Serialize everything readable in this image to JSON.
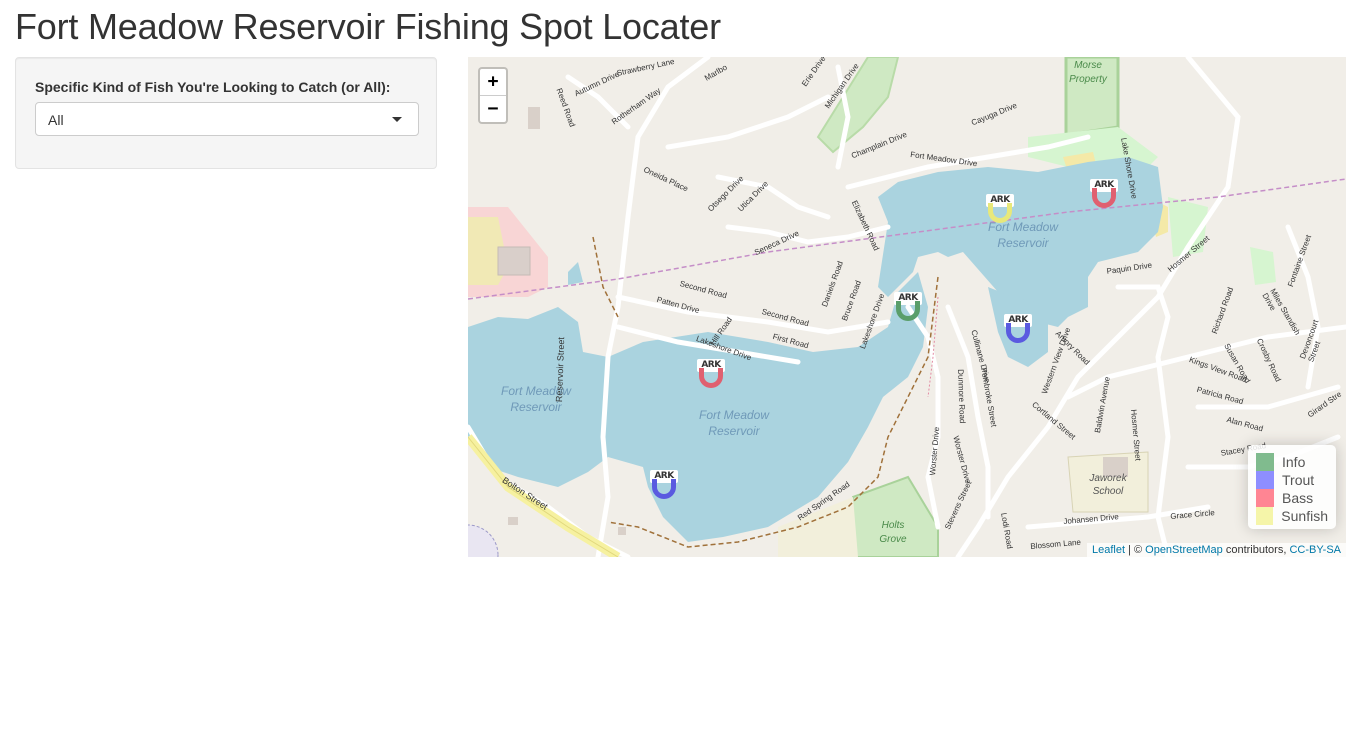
{
  "page": {
    "title": "Fort Meadow Reservoir Fishing Spot Locater"
  },
  "sidebar": {
    "label": "Specific Kind of Fish You're Looking to Catch (or All):",
    "select_value": "All"
  },
  "map": {
    "zoom_in": "+",
    "zoom_out": "−",
    "legend": [
      {
        "label": "Info",
        "color": "#6aaf7a"
      },
      {
        "label": "Trout",
        "color": "#7a7aff"
      },
      {
        "label": "Bass",
        "color": "#ff7080"
      },
      {
        "label": "Sunfish",
        "color": "#f3f39a"
      }
    ],
    "marker_badge": "ARK",
    "attribution": {
      "leaflet": "Leaflet",
      "sep": " | © ",
      "osm": "OpenStreetMap",
      "contributors": " contributors, ",
      "license": "CC-BY-SA"
    },
    "labels": {
      "water1": "Fort Meadow",
      "water1b": "Reservoir",
      "water2": "Fort Meadow",
      "water2b": "Reservoir",
      "water3": "Fort Meadow",
      "water3b": "Reservoir",
      "morse": "Morse",
      "morseb": "Property",
      "holts": "Holts",
      "holtsb": "Grove",
      "jaworek": "Jaworek",
      "jaworekb": "School",
      "streets": {
        "reservoir_st": "Reservoir Street",
        "bolton_st": "Bolton Street",
        "reed_rd": "Reed Road",
        "strawberry": "Strawberry Lane",
        "autumn": "Autumn Drive",
        "rotherham": "Rotherham Way",
        "marlboro": "Marlbo",
        "erie": "Erie Drive",
        "michigan": "Michigan Drive",
        "champlain": "Champlain Drive",
        "cayuga": "Cayuga Drive",
        "fort_meadow_dr": "Fort Meadow Drive",
        "oneida": "Oneida Place",
        "otsego": "Otsego Drive",
        "utica": "Utica Drive",
        "seneca": "Seneca Drive",
        "elizabeth": "Elizabeth Road",
        "second1": "Second Road",
        "second2": "Second Road",
        "patten": "Patten Drive",
        "hill": "Hill Road",
        "first": "First Road",
        "lakeshore1": "Lakeshore Drive",
        "lakeshore2": "Lakeshore Drive",
        "daniels": "Daniels Road",
        "bruce": "Bruce Road",
        "lake_shore_dr": "Lake Shore Drive",
        "paquin": "Paquin Drive",
        "hosmer1": "Hosmer Street",
        "hosmer2": "Hosmer Street",
        "fontaine": "Fontaine Street",
        "miles": "Miles Standish Drive",
        "richard": "Richard Road",
        "devoncourt": "Devoncourt Street",
        "crosby": "Crosby Road",
        "kings": "Kings View Road",
        "susan": "Susan Road",
        "patricia": "Patricia Road",
        "alan": "Alan Road",
        "girard": "Girard Stre",
        "stacey": "Stacey Road",
        "grace": "Grace Circle",
        "johansen": "Johansen Drive",
        "blossom": "Blossom Lane",
        "lodi": "Lodi Road",
        "stevens": "Stevens Street",
        "worster1": "Worster Drive",
        "worster2": "Worster Drive",
        "cortland": "Cortland Street",
        "baldwin": "Baldwin Avenue",
        "western": "Western View Drive",
        "amory": "Amory Road",
        "pembroke": "Pembroke Street",
        "cullinane": "Cullinane Drive",
        "dunmore": "Dunmore Road",
        "red_spring": "Red Spring Road"
      }
    }
  }
}
